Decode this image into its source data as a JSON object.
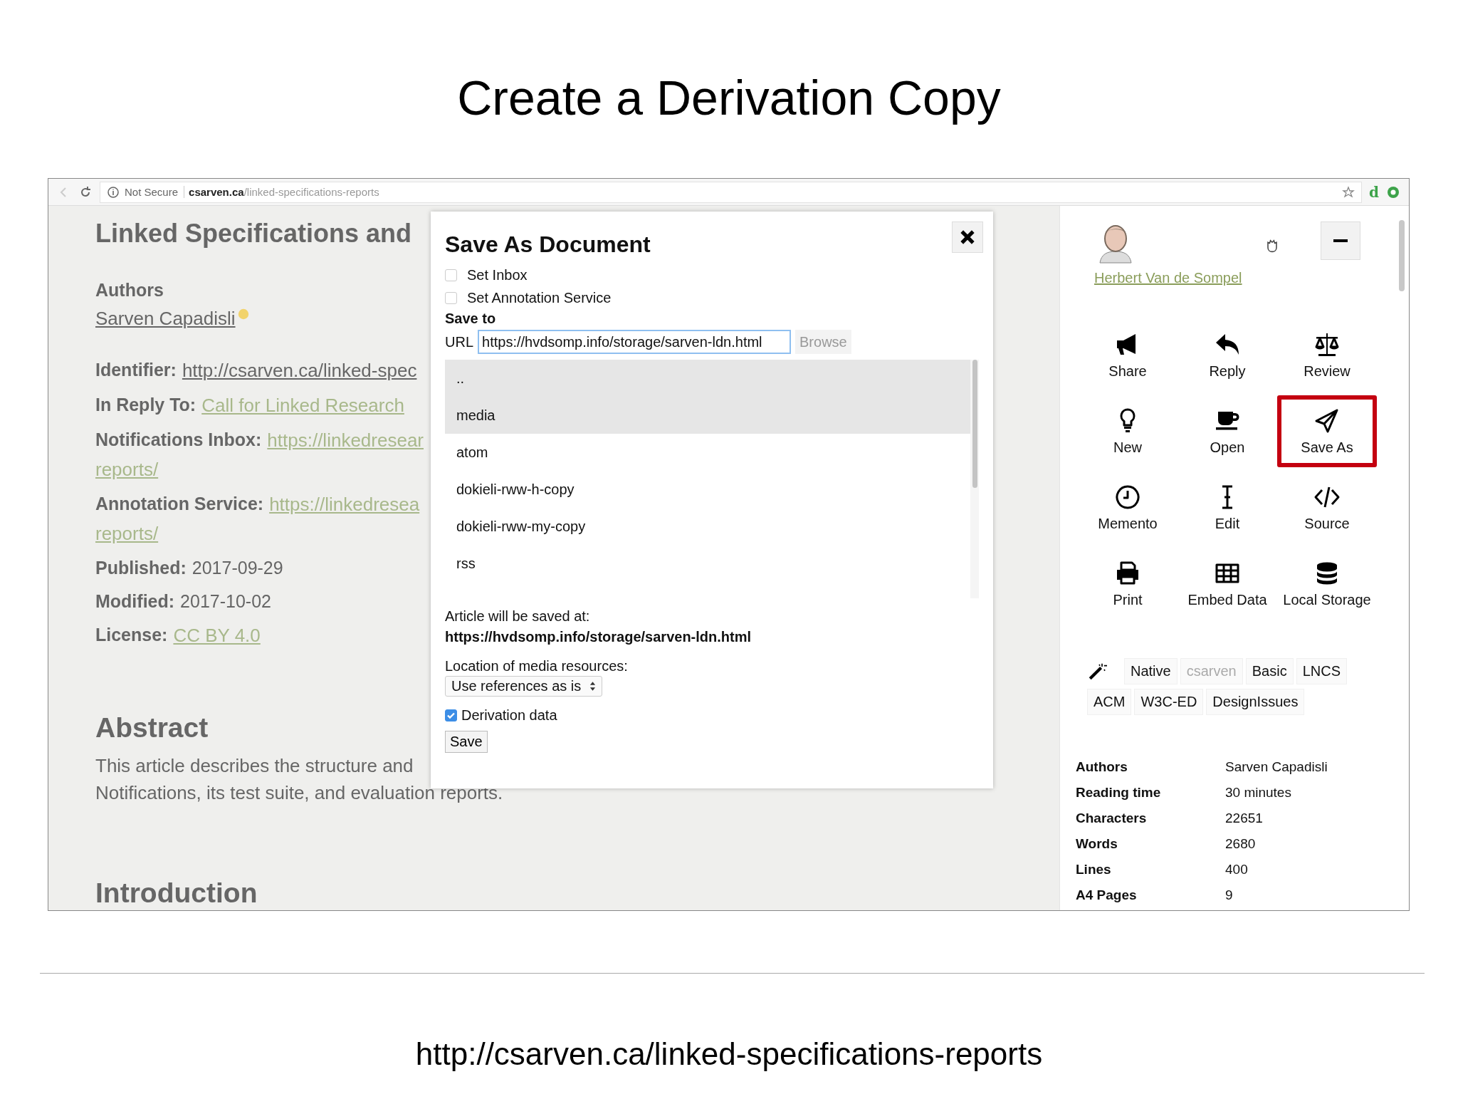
{
  "slide": {
    "title": "Create a Derivation Copy",
    "footer": "http://csarven.ca/linked-specifications-reports"
  },
  "browser": {
    "security": "Not Secure",
    "host": "csarven.ca",
    "path": "/linked-specifications-reports",
    "extension_label": "d"
  },
  "document": {
    "title": "Linked Specifications and",
    "authors_heading": "Authors",
    "author": "Sarven Capadisli",
    "meta": [
      {
        "label": "Identifier:",
        "value": "http://csarven.ca/linked-spec",
        "kind": "dark-link"
      },
      {
        "label": "In Reply To:",
        "value": "Call for Linked Research",
        "kind": "link"
      },
      {
        "label": "Notifications Inbox:",
        "value": "https://linkedresear",
        "continuation": "reports/",
        "kind": "link"
      },
      {
        "label": "Annotation Service:",
        "value": "https://linkedresea",
        "continuation": "reports/",
        "kind": "link"
      },
      {
        "label": "Published:",
        "value": "2017-09-29",
        "kind": "text"
      },
      {
        "label": "Modified:",
        "value": "2017-10-02",
        "kind": "text"
      },
      {
        "label": "License:",
        "value": "CC BY 4.0",
        "kind": "link"
      }
    ],
    "abstract_heading": "Abstract",
    "abstract_lines": [
      "This article describes the structure and",
      "Notifications, its test suite, and evaluation reports."
    ],
    "introduction_heading": "Introduction"
  },
  "dialog": {
    "title": "Save As Document",
    "options": [
      {
        "label": "Set Inbox",
        "checked": false
      },
      {
        "label": "Set Annotation Service",
        "checked": false
      }
    ],
    "save_to_label": "Save to",
    "url_label": "URL",
    "url_value": "https://hvdsomp.info/storage/sarven-ldn.html",
    "browse_button": "Browse",
    "folders": [
      {
        "name": "..",
        "selected": true
      },
      {
        "name": "media",
        "selected": true
      },
      {
        "name": "atom",
        "selected": false
      },
      {
        "name": "dokieli-rww-h-copy",
        "selected": false
      },
      {
        "name": "dokieli-rww-my-copy",
        "selected": false
      },
      {
        "name": "rss",
        "selected": false
      }
    ],
    "saved_at_label": "Article will be saved at:",
    "saved_at_url": "https://hvdsomp.info/storage/sarven-ldn.html",
    "media_label": "Location of media resources:",
    "media_select": "Use references as is",
    "derivation": {
      "label": "Derivation data",
      "checked": true
    },
    "save_button": "Save"
  },
  "panel": {
    "user": "Herbert Van de Sompel",
    "actions": [
      {
        "label": "Share",
        "highlighted": false
      },
      {
        "label": "Reply",
        "highlighted": false
      },
      {
        "label": "Review",
        "highlighted": false
      },
      {
        "label": "New",
        "highlighted": false
      },
      {
        "label": "Open",
        "highlighted": false
      },
      {
        "label": "Save As",
        "highlighted": true
      },
      {
        "label": "Memento",
        "highlighted": false
      },
      {
        "label": "Edit",
        "highlighted": false
      },
      {
        "label": "Source",
        "highlighted": false
      },
      {
        "label": "Print",
        "highlighted": false
      },
      {
        "label": "Embed Data",
        "highlighted": false
      },
      {
        "label": "Local Storage",
        "highlighted": false
      }
    ],
    "styles": [
      {
        "label": "Native",
        "selected": false
      },
      {
        "label": "csarven",
        "selected": true
      },
      {
        "label": "Basic",
        "selected": false
      },
      {
        "label": "LNCS",
        "selected": false
      },
      {
        "label": "ACM",
        "selected": false
      },
      {
        "label": "W3C-ED",
        "selected": false
      },
      {
        "label": "DesignIssues",
        "selected": false
      }
    ],
    "stats": [
      {
        "label": "Authors",
        "value": "Sarven Capadisli"
      },
      {
        "label": "Reading time",
        "value": "30 minutes"
      },
      {
        "label": "Characters",
        "value": "22651"
      },
      {
        "label": "Words",
        "value": "2680"
      },
      {
        "label": "Lines",
        "value": "400"
      },
      {
        "label": "A4 Pages",
        "value": "9"
      }
    ]
  }
}
